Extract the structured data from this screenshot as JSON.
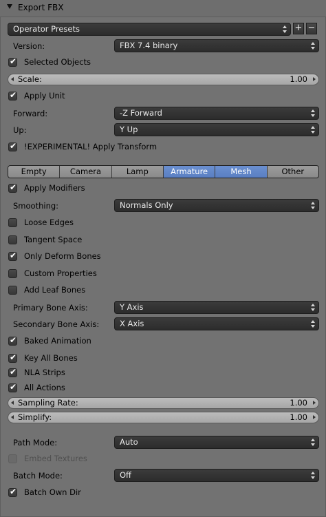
{
  "header": {
    "title": "Export FBX"
  },
  "presets": {
    "label": "Operator Presets"
  },
  "main": {
    "version_label": "Version:",
    "version_value": "FBX 7.4 binary",
    "selected_objects": "Selected Objects",
    "scale_label": "Scale:",
    "scale_value": "1.00",
    "apply_unit": "Apply Unit",
    "forward_label": "Forward:",
    "forward_value": "-Z Forward",
    "up_label": "Up:",
    "up_value": "Y Up",
    "apply_transform": "!EXPERIMENTAL! Apply Transform"
  },
  "tabs": [
    "Empty",
    "Camera",
    "Lamp",
    "Armature",
    "Mesh",
    "Other"
  ],
  "mesh": {
    "apply_modifiers": "Apply Modifiers",
    "smoothing_label": "Smoothing:",
    "smoothing_value": "Normals Only",
    "loose_edges": "Loose Edges",
    "tangent_space": "Tangent Space"
  },
  "armature": {
    "only_deform_bones": "Only Deform Bones",
    "custom_properties": "Custom Properties",
    "add_leaf_bones": "Add Leaf Bones",
    "primary_axis_label": "Primary Bone Axis:",
    "primary_axis_value": "Y Axis",
    "secondary_axis_label": "Secondary Bone Axis:",
    "secondary_axis_value": "X Axis"
  },
  "animation": {
    "baked_animation": "Baked Animation",
    "key_all_bones": "Key All Bones",
    "nla_strips": "NLA Strips",
    "all_actions": "All Actions",
    "sampling_rate_label": "Sampling Rate:",
    "sampling_rate_value": "1.00",
    "simplify_label": "Simplify:",
    "simplify_value": "1.00"
  },
  "export": {
    "path_mode_label": "Path Mode:",
    "path_mode_value": "Auto",
    "embed_textures": "Embed Textures",
    "batch_mode_label": "Batch Mode:",
    "batch_mode_value": "Off",
    "batch_own_dir": "Batch Own Dir"
  },
  "colors": {
    "active_tab": "#5a7fc2",
    "panel_bg": "#727272",
    "dropdown_bg": "#2c2c2c"
  }
}
